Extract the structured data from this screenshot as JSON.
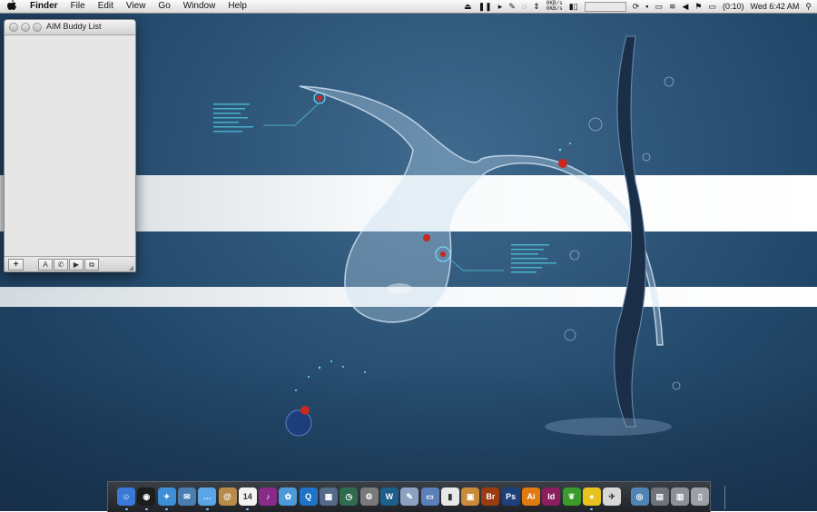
{
  "menubar": {
    "apple_icon": "apple-logo-icon",
    "app_name": "Finder",
    "menus": [
      "File",
      "Edit",
      "View",
      "Go",
      "Window",
      "Help"
    ],
    "net_up": "0KB/s",
    "net_down": "0KB/s",
    "battery": "(0:10)",
    "clock": "Wed 6:42 AM"
  },
  "buddy_window": {
    "title": "AIM Buddy List",
    "add_label": "+",
    "text_label": "A"
  },
  "dock": {
    "items": [
      {
        "name": "Finder",
        "icon": "finder-icon",
        "color": "#3a7ad6",
        "glyph": "☺",
        "running": true
      },
      {
        "name": "Dashboard",
        "icon": "dashboard-icon",
        "color": "#1d1d1d",
        "glyph": "◉",
        "running": true
      },
      {
        "name": "Safari",
        "icon": "safari-icon",
        "color": "#3d8fd8",
        "glyph": "✦",
        "running": true
      },
      {
        "name": "Mail",
        "icon": "mail-icon",
        "color": "#4a7db0",
        "glyph": "✉",
        "running": false
      },
      {
        "name": "iChat",
        "icon": "ichat-icon",
        "color": "#5aa5e6",
        "glyph": "…",
        "running": true
      },
      {
        "name": "Address Book",
        "icon": "address-book-icon",
        "color": "#b88b4a",
        "glyph": "@",
        "running": false
      },
      {
        "name": "iCal",
        "icon": "ical-icon",
        "color": "#f2f2f2",
        "glyph": "14",
        "running": true
      },
      {
        "name": "iTunes",
        "icon": "itunes-icon",
        "color": "#8a2b8c",
        "glyph": "♪",
        "running": false
      },
      {
        "name": "iPhoto",
        "icon": "iphoto-icon",
        "color": "#4d9ad8",
        "glyph": "✿",
        "running": false
      },
      {
        "name": "QuickTime",
        "icon": "quicktime-icon",
        "color": "#1e74c8",
        "glyph": "Q",
        "running": false
      },
      {
        "name": "Spaces",
        "icon": "spaces-icon",
        "color": "#546a88",
        "glyph": "▦",
        "running": false
      },
      {
        "name": "Time Machine",
        "icon": "time-machine-icon",
        "color": "#2f6b4f",
        "glyph": "◷",
        "running": false
      },
      {
        "name": "System Preferences",
        "icon": "system-preferences-icon",
        "color": "#7a7a7a",
        "glyph": "⚙",
        "running": false
      },
      {
        "name": "Dreamweaver",
        "icon": "dreamweaver-icon",
        "color": "#1d5e8c",
        "glyph": "W",
        "running": false
      },
      {
        "name": "Script Editor",
        "icon": "script-editor-icon",
        "color": "#8ba2c2",
        "glyph": "✎",
        "running": false
      },
      {
        "name": "Keynote",
        "icon": "keynote-icon",
        "color": "#5b7fb8",
        "glyph": "▭",
        "running": false
      },
      {
        "name": "Chart",
        "icon": "chart-icon",
        "color": "#e8e8e8",
        "glyph": "▮",
        "running": false
      },
      {
        "name": "Preview",
        "icon": "preview-icon",
        "color": "#c98a3a",
        "glyph": "▣",
        "running": false
      },
      {
        "name": "Br",
        "icon": "bridge-icon",
        "color": "#9a3b12",
        "glyph": "Br",
        "running": false
      },
      {
        "name": "Ps",
        "icon": "photoshop-icon",
        "color": "#1d3f7a",
        "glyph": "Ps",
        "running": false
      },
      {
        "name": "Ai",
        "icon": "illustrator-icon",
        "color": "#e07a10",
        "glyph": "Ai",
        "running": false
      },
      {
        "name": "Id",
        "icon": "indesign-icon",
        "color": "#8a1e5e",
        "glyph": "Id",
        "running": false
      },
      {
        "name": "Leaf",
        "icon": "leaf-icon",
        "color": "#3a9a2a",
        "glyph": "❦",
        "running": false
      },
      {
        "name": "Adium",
        "icon": "adium-duck-icon",
        "color": "#e8c21e",
        "glyph": "●",
        "running": true
      },
      {
        "name": "AIM",
        "icon": "aim-icon",
        "color": "#d8d8d8",
        "glyph": "✈",
        "running": false
      },
      {
        "name": "Network",
        "icon": "network-globe-icon",
        "color": "#4f84b4",
        "glyph": "◎",
        "running": false
      },
      {
        "name": "Applications",
        "icon": "applications-stack-icon",
        "color": "#6f747b",
        "glyph": "▤",
        "running": false
      },
      {
        "name": "Documents",
        "icon": "documents-stack-icon",
        "color": "#8d9096",
        "glyph": "▥",
        "running": false
      },
      {
        "name": "Trash",
        "icon": "trash-icon",
        "color": "#9aa0a6",
        "glyph": "▯",
        "running": false
      }
    ]
  }
}
